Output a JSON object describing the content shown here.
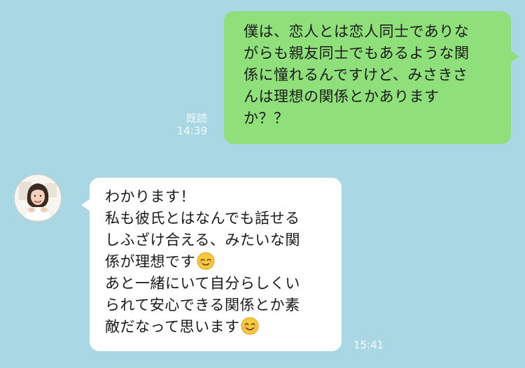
{
  "chat": {
    "outgoing": {
      "lines": [
        "僕は、恋人とは恋人同士でありな",
        "がらも親友同士でもあるような関",
        "係に憧れるんですけど、みさきさ",
        "んは理想の関係とかありますか？？"
      ],
      "line_5": "か？？",
      "read_label": "既読",
      "time": "14:39"
    },
    "incoming": {
      "avatar": "profile-photo",
      "lines": [
        "わかります！",
        "私も彼氏とはなんでも話せる",
        "しふざけ合える、みたいな関",
        "係が理想です",
        "あと一緒にいて自分らしくい",
        "られて安心できる関係とか素",
        "敵だなって思います"
      ],
      "time": "15:41",
      "emojis": [
        "relieved-face-emoji",
        "smiling-face-emoji"
      ]
    }
  },
  "colors": {
    "background": "#a9d8e4",
    "outgoing_bubble": "#8fe07b",
    "incoming_bubble": "#ffffff"
  }
}
